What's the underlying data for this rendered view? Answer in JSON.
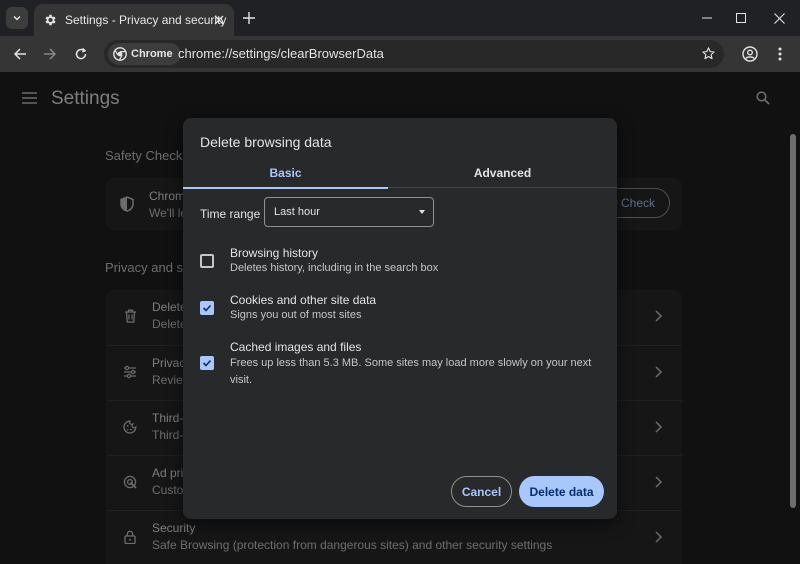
{
  "browser": {
    "tab_title": "Settings - Privacy and security",
    "chip_label": "Chrome",
    "url": "chrome://settings/clearBrowserData"
  },
  "page": {
    "title": "Settings",
    "safety_check": {
      "section_title": "Safety Check",
      "row_title": "Chrom",
      "row_sub": "We'll le",
      "button_fragment": "y Check"
    },
    "privacy": {
      "section_title": "Privacy and se",
      "rows": [
        {
          "title": "Delete",
          "sub": "Delete",
          "icon": "trash-icon"
        },
        {
          "title": "Privacy",
          "sub": "Review",
          "icon": "tune-icon"
        },
        {
          "title": "Third-",
          "sub": "Third-",
          "icon": "cookie-icon"
        },
        {
          "title": "Ad pri",
          "sub": "Custo",
          "icon": "ad-privacy-icon"
        },
        {
          "title": "Security",
          "sub": "Safe Browsing (protection from dangerous sites) and other security settings",
          "icon": "lock-icon"
        }
      ]
    }
  },
  "dialog": {
    "title": "Delete browsing data",
    "tabs": {
      "basic": "Basic",
      "advanced": "Advanced"
    },
    "time_range_label": "Time range",
    "time_range_value": "Last hour",
    "options": [
      {
        "title": "Browsing history",
        "sub": "Deletes history, including in the search box",
        "checked": false
      },
      {
        "title": "Cookies and other site data",
        "sub": "Signs you out of most sites",
        "checked": true
      },
      {
        "title": "Cached images and files",
        "sub": "Frees up less than 5.3 MB. Some sites may load more slowly on your next visit.",
        "checked": true
      }
    ],
    "cancel_label": "Cancel",
    "delete_label": "Delete data"
  },
  "colors": {
    "accent": "#a8c7fa",
    "dialog_bg": "#28292a",
    "page_bg": "#1f1f1f"
  }
}
